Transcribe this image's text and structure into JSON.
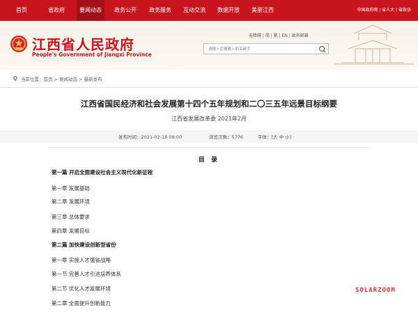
{
  "topnav": {
    "items": [
      {
        "label": "首页"
      },
      {
        "label": "省政府"
      },
      {
        "label": "要闻动态"
      },
      {
        "label": "政务公开"
      },
      {
        "label": "政务服务"
      },
      {
        "label": "互动交流"
      },
      {
        "label": "数据开放"
      },
      {
        "label": "美丽江西"
      }
    ],
    "active_index": 2,
    "right_links": "中国政府网 | 省人大 | 省政协"
  },
  "header": {
    "logo_cn": "江西省人民政府",
    "logo_en": "People's Government of Jiangxi Province",
    "tools": "无障碍 | 简 | 繁 | EN | 政务邮箱",
    "search_placeholder": "请输入您要输入的关键字"
  },
  "breadcrumb": "当前位置：首页 > 要闻动态 > 最新发布",
  "article": {
    "title": "江西省国民经济和社会发展第十四个五年规划和二〇三五年远景目标纲要",
    "subtitle": "江西省发展改革委 2021年2月",
    "publish_time": "发布时间：2021-02-18 09:00",
    "views": "浏览次数：5776",
    "font_size": "字体：[大 中 小]"
  },
  "toc": {
    "heading": "目 录",
    "entries": [
      {
        "text": "第一篇 开启全面建设社会主义现代化新征程",
        "bold": true
      },
      {
        "text": "第一章 发展基础",
        "bold": false
      },
      {
        "text": "第二章 发展环境",
        "bold": false
      },
      {
        "text": "第三章 总体要求",
        "bold": false
      },
      {
        "text": "第四章 发展目标",
        "bold": false
      },
      {
        "text": "第二篇 加快建设创新型省份",
        "bold": true
      },
      {
        "text": "第一章 实施人才强省战略",
        "bold": false
      },
      {
        "text": "第一节 完善人才引进培养体系",
        "bold": false
      },
      {
        "text": "第二节 优化人才发展环境",
        "bold": false
      },
      {
        "text": "第二章 全面提升创新能力",
        "bold": false
      }
    ]
  },
  "watermark": "SOLARZOOM",
  "colors": {
    "brand_red": "#c8141d",
    "header_bg": "#f7f3ea"
  }
}
